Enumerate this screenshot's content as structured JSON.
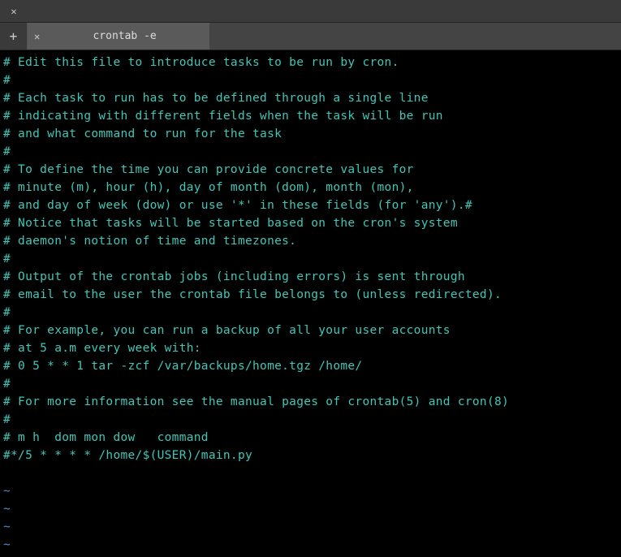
{
  "titlebar": {},
  "tabs": {
    "tab1": {
      "title": "crontab -e"
    }
  },
  "lines": [
    "# Edit this file to introduce tasks to be run by cron.",
    "#",
    "# Each task to run has to be defined through a single line",
    "# indicating with different fields when the task will be run",
    "# and what command to run for the task",
    "#",
    "# To define the time you can provide concrete values for",
    "# minute (m), hour (h), day of month (dom), month (mon),",
    "# and day of week (dow) or use '*' in these fields (for 'any').#",
    "# Notice that tasks will be started based on the cron's system",
    "# daemon's notion of time and timezones.",
    "#",
    "# Output of the crontab jobs (including errors) is sent through",
    "# email to the user the crontab file belongs to (unless redirected).",
    "#",
    "# For example, you can run a backup of all your user accounts",
    "# at 5 a.m every week with:",
    "# 0 5 * * 1 tar -zcf /var/backups/home.tgz /home/",
    "#",
    "# For more information see the manual pages of crontab(5) and cron(8)",
    "#",
    "# m h  dom mon dow   command",
    "#*/5 * * * * /home/$(USER)/main.py"
  ],
  "tildes": [
    "~",
    "~",
    "~",
    "~"
  ]
}
